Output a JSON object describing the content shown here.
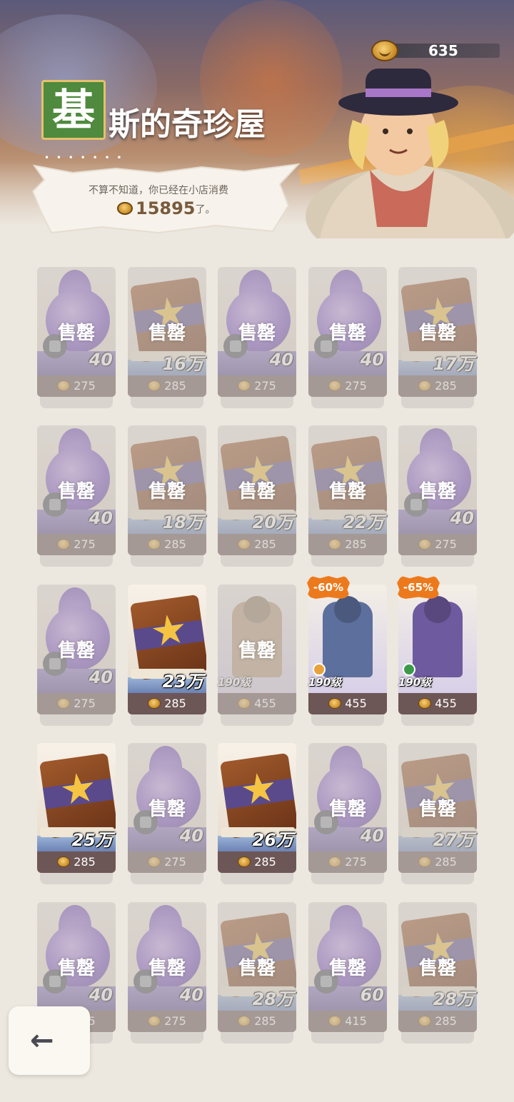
{
  "header": {
    "currency_amount": "635",
    "title_first_char": "基",
    "title_rest": "斯的奇珍屋",
    "dots": "• • • • • • •",
    "speech_line1": "不算不知道，你已经在小店消费",
    "spent_amount": "15895",
    "speech_suffix": "了。"
  },
  "sold_label": "售罄",
  "items": [
    {
      "type": "orb",
      "qty": "40",
      "price": "275",
      "sold": true
    },
    {
      "type": "book",
      "qty": "16万",
      "price": "285",
      "sold": true
    },
    {
      "type": "orb",
      "qty": "40",
      "price": "275",
      "sold": true
    },
    {
      "type": "orb",
      "qty": "40",
      "price": "275",
      "sold": true
    },
    {
      "type": "book",
      "qty": "17万",
      "price": "285",
      "sold": true
    },
    {
      "type": "orb",
      "qty": "40",
      "price": "275",
      "sold": true
    },
    {
      "type": "book",
      "qty": "18万",
      "price": "285",
      "sold": true
    },
    {
      "type": "book",
      "qty": "20万",
      "price": "285",
      "sold": true
    },
    {
      "type": "book",
      "qty": "22万",
      "price": "285",
      "sold": true
    },
    {
      "type": "orb",
      "qty": "40",
      "price": "275",
      "sold": true
    },
    {
      "type": "orb",
      "qty": "40",
      "price": "275",
      "sold": true
    },
    {
      "type": "book",
      "qty": "23万",
      "price": "285",
      "sold": false
    },
    {
      "type": "hero",
      "level": "190级",
      "price": "455",
      "sold": true,
      "color": "#b89a7a"
    },
    {
      "type": "hero",
      "level": "190级",
      "price": "455",
      "sold": false,
      "discount": "-60%",
      "color": "#5d6f9c",
      "role_color": "#e8a23a"
    },
    {
      "type": "hero",
      "level": "190级",
      "price": "455",
      "sold": false,
      "discount": "-65%",
      "color": "#6e5a9e",
      "role_color": "#3a9a4a"
    },
    {
      "type": "book",
      "qty": "25万",
      "price": "285",
      "sold": false
    },
    {
      "type": "orb",
      "qty": "40",
      "price": "275",
      "sold": true
    },
    {
      "type": "book",
      "qty": "26万",
      "price": "285",
      "sold": false
    },
    {
      "type": "orb",
      "qty": "40",
      "price": "275",
      "sold": true
    },
    {
      "type": "book",
      "qty": "27万",
      "price": "285",
      "sold": true
    },
    {
      "type": "orb",
      "qty": "40",
      "price": "275",
      "sold": true
    },
    {
      "type": "orb",
      "qty": "40",
      "price": "275",
      "sold": true
    },
    {
      "type": "book",
      "qty": "28万",
      "price": "285",
      "sold": true
    },
    {
      "type": "orb",
      "qty": "60",
      "price": "415",
      "sold": true
    },
    {
      "type": "book",
      "qty": "28万",
      "price": "285",
      "sold": true
    }
  ],
  "back_button": {
    "icon": "back-arrow-icon",
    "glyph": "←"
  }
}
